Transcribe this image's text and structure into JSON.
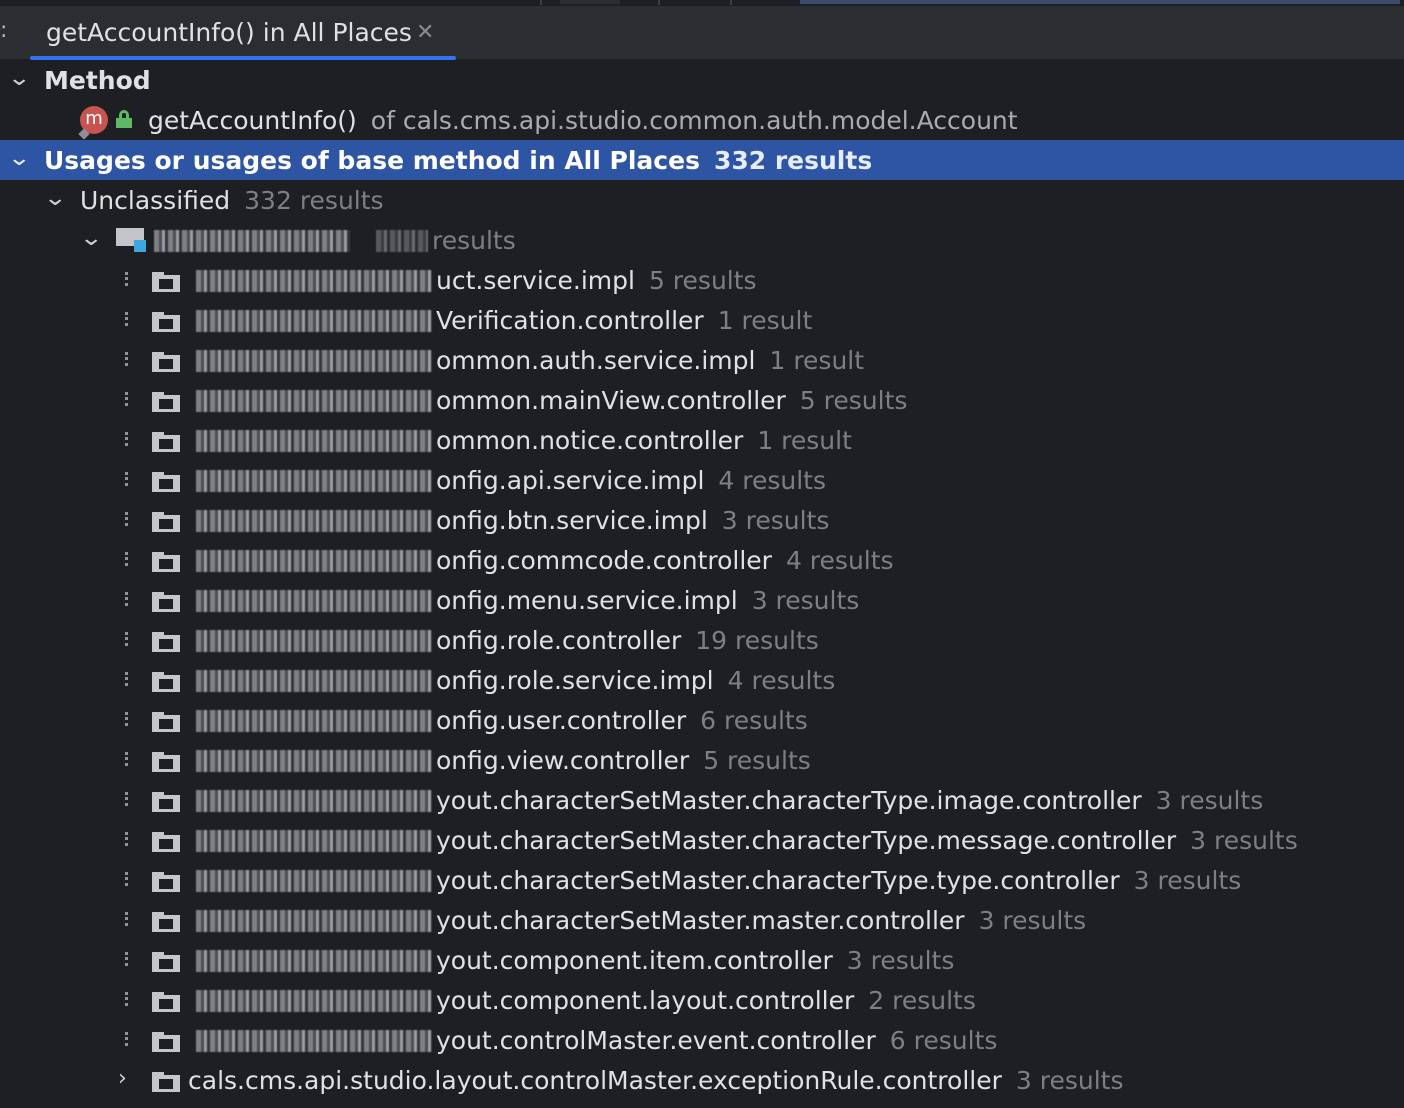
{
  "tab": {
    "colon": ":",
    "title": "getAccountInfo() in All Places",
    "close_glyph": "✕"
  },
  "tree": {
    "method_header": "Method",
    "method_item": {
      "name": "getAccountInfo()",
      "of_text": "of cals.cms.api.studio.common.auth.model.Account",
      "icon_letter": "m"
    },
    "usages_header": {
      "label": "Usages or usages of base method in All Places",
      "count": "332 results"
    },
    "unclassified": {
      "label": "Unclassified",
      "count": "332 results"
    },
    "module": {
      "count_suffix": "results"
    },
    "packages": [
      {
        "name_visible": "uct.service.impl",
        "count": "5 results"
      },
      {
        "name_visible": "Verification.controller",
        "count": "1 result"
      },
      {
        "name_visible": "ommon.auth.service.impl",
        "count": "1 result"
      },
      {
        "name_visible": "ommon.mainView.controller",
        "count": "5 results"
      },
      {
        "name_visible": "ommon.notice.controller",
        "count": "1 result"
      },
      {
        "name_visible": "onfig.api.service.impl",
        "count": "4 results"
      },
      {
        "name_visible": "onfig.btn.service.impl",
        "count": "3 results"
      },
      {
        "name_visible": "onfig.commcode.controller",
        "count": "4 results"
      },
      {
        "name_visible": "onfig.menu.service.impl",
        "count": "3 results"
      },
      {
        "name_visible": "onfig.role.controller",
        "count": "19 results"
      },
      {
        "name_visible": "onfig.role.service.impl",
        "count": "4 results"
      },
      {
        "name_visible": "onfig.user.controller",
        "count": "6 results"
      },
      {
        "name_visible": "onfig.view.controller",
        "count": "5 results"
      },
      {
        "name_visible": "yout.characterSetMaster.characterType.image.controller",
        "count": "3 results"
      },
      {
        "name_visible": "yout.characterSetMaster.characterType.message.controller",
        "count": "3 results"
      },
      {
        "name_visible": "yout.characterSetMaster.characterType.type.controller",
        "count": "3 results"
      },
      {
        "name_visible": "yout.characterSetMaster.master.controller",
        "count": "3 results"
      },
      {
        "name_visible": "yout.component.item.controller",
        "count": "3 results"
      },
      {
        "name_visible": "yout.component.layout.controller",
        "count": "2 results"
      },
      {
        "name_visible": "yout.controlMaster.event.controller",
        "count": "6 results"
      }
    ],
    "last_package": {
      "name": "cals.cms.api.studio.layout.controlMaster.exceptionRule.controller",
      "count": "3 results"
    }
  },
  "colors": {
    "background": "#1e1f22",
    "header": "#2b2d30",
    "selection": "#2e55a3",
    "accent": "#3574f0",
    "muted_text": "#7c7f86"
  },
  "icons": {
    "expand": "chevron-down-icon",
    "collapse": "chevron-right-icon",
    "package": "folder-package-icon",
    "method": "method-icon",
    "access": "lock-icon"
  }
}
